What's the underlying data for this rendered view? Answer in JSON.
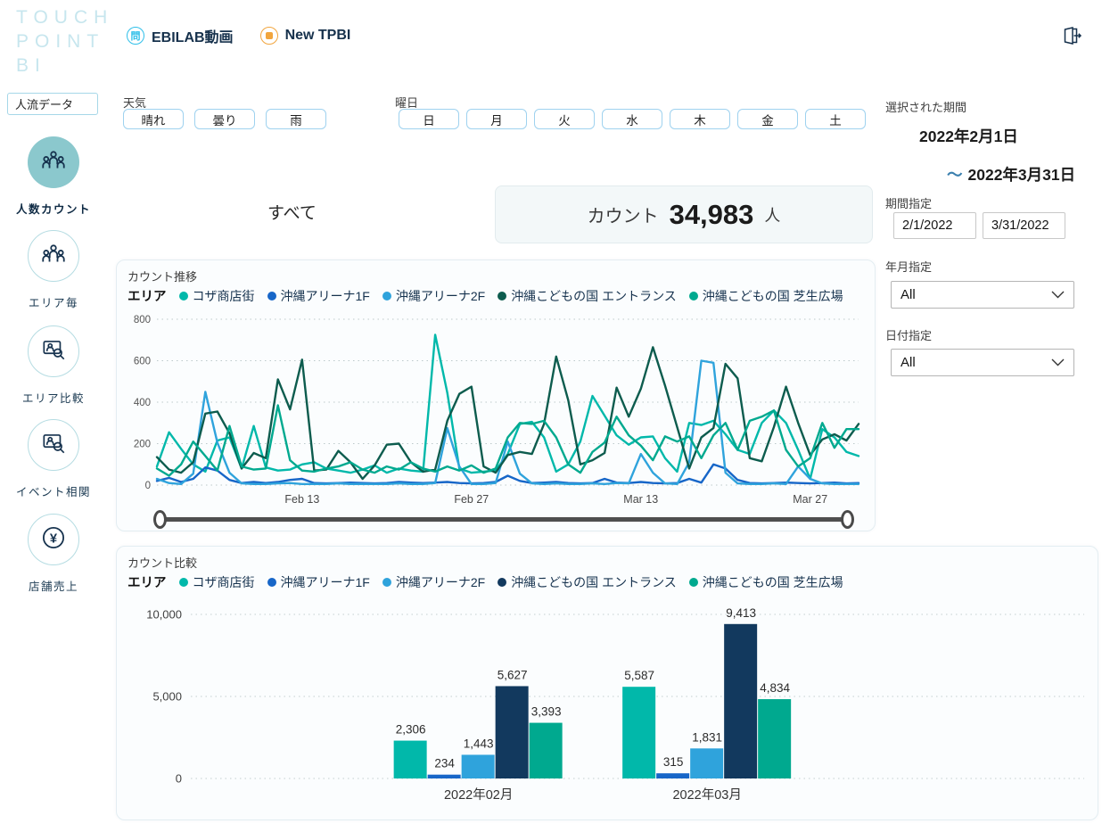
{
  "logo": {
    "line1": "TOUCH",
    "line2": "POINT",
    "line3": "BI"
  },
  "header": {
    "tabs": [
      {
        "label": "EBILAB動画",
        "icon": "question-circle-icon",
        "icon_char": "問"
      },
      {
        "label": "New TPBI",
        "icon": "orange-square-circle-icon"
      }
    ]
  },
  "sidebar": {
    "filter_input_value": "人流データ",
    "items": [
      {
        "label": "人数カウント",
        "icon": "people-icon",
        "active": true
      },
      {
        "label": "エリア毎",
        "icon": "people-icon",
        "active": false
      },
      {
        "label": "エリア比較",
        "icon": "area-compare-icon",
        "active": false
      },
      {
        "label": "イベント相関",
        "icon": "event-correlation-icon",
        "active": false
      },
      {
        "label": "店舗売上",
        "icon": "yen-icon",
        "active": false
      }
    ]
  },
  "filters": {
    "weather": {
      "label": "天気",
      "options": [
        "晴れ",
        "曇り",
        "雨"
      ]
    },
    "weekday": {
      "label": "曜日",
      "options": [
        "日",
        "月",
        "火",
        "水",
        "木",
        "金",
        "土"
      ]
    }
  },
  "summary": {
    "scope": "すべて",
    "count_label": "カウント",
    "count_value": "34,983",
    "count_unit": "人"
  },
  "period_panel": {
    "selected_label": "選択された期間",
    "start_date": "2022年2月1日",
    "tilde": "～",
    "end_date": "2022年3月31日",
    "range_label": "期間指定",
    "start_input": "2/1/2022",
    "end_input": "3/31/2022",
    "month_label": "年月指定",
    "month_value": "All",
    "date_label": "日付指定",
    "date_value": "All"
  },
  "colors": {
    "logo": "#c7e6ee",
    "header_text": "#16314c",
    "active_nav": "#8bc8cd",
    "nav_icon": "#16324e",
    "button_border": "#9fd2ef",
    "tilde": "#3a7fae"
  },
  "chart_data": [
    {
      "type": "line",
      "title": "カウント推移",
      "legend_label": "エリア",
      "legend_position": "top",
      "grid": "dotted-horizontal",
      "x_start": "2022-02-01",
      "x_end": "2022-03-31",
      "x_tick_labels": [
        "Feb 13",
        "Feb 27",
        "Mar 13",
        "Mar 27"
      ],
      "x_tick_indices": [
        12,
        26,
        40,
        54
      ],
      "ylim": [
        0,
        800
      ],
      "yticks": [
        0,
        200,
        400,
        600,
        800
      ],
      "series": [
        {
          "name": "コザ商店街",
          "color": "#01B8AA",
          "values": [
            90,
            255,
            175,
            100,
            65,
            215,
            230,
            80,
            285,
            85,
            70,
            75,
            100,
            110,
            80,
            70,
            60,
            75,
            95,
            60,
            80,
            70,
            65,
            725,
            445,
            80,
            60,
            65,
            70,
            150,
            295,
            305,
            230,
            65,
            100,
            210,
            430,
            335,
            240,
            195,
            230,
            235,
            130,
            65,
            300,
            290,
            310,
            245,
            170,
            150,
            300,
            360,
            300,
            170,
            30,
            270,
            230,
            160,
            140
          ]
        },
        {
          "name": "沖縄アリーナ1F",
          "color": "#1766C8",
          "values": [
            20,
            35,
            15,
            30,
            85,
            70,
            25,
            10,
            15,
            10,
            15,
            25,
            30,
            10,
            8,
            10,
            12,
            10,
            8,
            10,
            15,
            12,
            10,
            12,
            15,
            10,
            8,
            10,
            15,
            45,
            20,
            10,
            12,
            15,
            10,
            8,
            10,
            30,
            12,
            10,
            15,
            10,
            8,
            10,
            30,
            12,
            100,
            80,
            25,
            10,
            8,
            10,
            12,
            10,
            8,
            10,
            12,
            8,
            10
          ]
        },
        {
          "name": "沖縄アリーナ2F",
          "color": "#2FA3DC",
          "values": [
            30,
            10,
            5,
            55,
            450,
            205,
            60,
            8,
            5,
            5,
            8,
            10,
            5,
            5,
            5,
            8,
            5,
            5,
            5,
            5,
            8,
            5,
            5,
            10,
            275,
            90,
            5,
            5,
            10,
            210,
            55,
            8,
            5,
            8,
            5,
            5,
            8,
            5,
            10,
            8,
            150,
            60,
            8,
            5,
            110,
            600,
            590,
            60,
            8,
            5,
            5,
            8,
            5,
            90,
            30,
            8,
            5,
            5,
            5
          ]
        },
        {
          "name": "沖縄こどもの国 エントランス",
          "color": "#0D5C4E",
          "values": [
            135,
            75,
            60,
            110,
            345,
            355,
            250,
            80,
            155,
            130,
            510,
            365,
            605,
            70,
            75,
            165,
            110,
            30,
            95,
            195,
            200,
            110,
            65,
            75,
            310,
            440,
            475,
            90,
            60,
            145,
            160,
            150,
            295,
            620,
            410,
            100,
            120,
            155,
            470,
            330,
            465,
            665,
            480,
            280,
            80,
            230,
            275,
            585,
            515,
            130,
            115,
            280,
            475,
            300,
            145,
            220,
            245,
            215,
            295
          ]
        },
        {
          "name": "沖縄こどもの国 芝生広場",
          "color": "#00A98F",
          "values": [
            80,
            45,
            100,
            210,
            140,
            70,
            285,
            90,
            75,
            80,
            385,
            120,
            70,
            65,
            80,
            90,
            110,
            75,
            60,
            90,
            75,
            110,
            80,
            65,
            90,
            70,
            95,
            60,
            80,
            230,
            300,
            295,
            310,
            230,
            100,
            60,
            160,
            205,
            330,
            240,
            190,
            120,
            235,
            210,
            235,
            130,
            240,
            300,
            170,
            310,
            330,
            360,
            170,
            90,
            130,
            300,
            180,
            270,
            270
          ]
        }
      ]
    },
    {
      "type": "bar",
      "title": "カウント比較",
      "legend_label": "エリア",
      "legend_position": "top",
      "grid": "dotted-horizontal",
      "categories": [
        "2022年02月",
        "2022年03月"
      ],
      "ylim": [
        0,
        10000
      ],
      "yticks": [
        0,
        5000,
        10000
      ],
      "ytick_labels": [
        "0",
        "5,000",
        "10,000"
      ],
      "series": [
        {
          "name": "コザ商店街",
          "color": "#01B8AA",
          "values": [
            2306,
            5587
          ]
        },
        {
          "name": "沖縄アリーナ1F",
          "color": "#1766C8",
          "values": [
            234,
            315
          ]
        },
        {
          "name": "沖縄アリーナ2F",
          "color": "#2FA3DC",
          "values": [
            1443,
            1831
          ]
        },
        {
          "name": "沖縄こどもの国 エントランス",
          "color": "#12395E",
          "values": [
            5627,
            9413
          ]
        },
        {
          "name": "沖縄こどもの国 芝生広場",
          "color": "#00A98F",
          "values": [
            3393,
            4834
          ]
        }
      ]
    }
  ]
}
